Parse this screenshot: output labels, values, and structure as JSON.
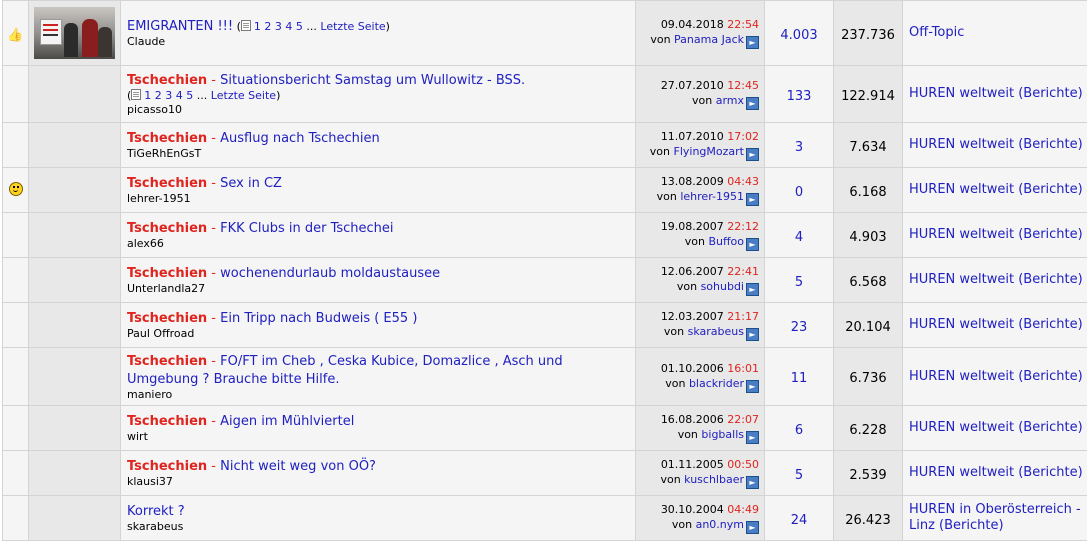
{
  "threads": [
    {
      "row_icon": "thumbs-up-icon",
      "has_thumbnail": true,
      "prefix": "",
      "title": "EMIGRANTEN !!!",
      "pages": [
        "1",
        "2",
        "3",
        "4",
        "5"
      ],
      "pages_ellipsis": "...",
      "last_page_label": "Letzte Seite",
      "starter": "Claude",
      "last_date": "09.04.2018",
      "last_time": "22:54",
      "last_by_label": "von",
      "last_user": "Panama Jack",
      "replies": "4.003",
      "views": "237.736",
      "forum": "Off-Topic"
    },
    {
      "row_icon": "",
      "has_thumbnail": false,
      "prefix": "Tschechien",
      "title": "Situationsbericht Samstag um Wullowitz - BSS.",
      "pages": [
        "1",
        "2",
        "3",
        "4",
        "5"
      ],
      "pages_ellipsis": "...",
      "last_page_label": "Letzte Seite",
      "starter": "picasso10",
      "last_date": "27.07.2010",
      "last_time": "12:45",
      "last_by_label": "von",
      "last_user": "armx",
      "replies": "133",
      "views": "122.914",
      "forum": "HUREN weltweit (Berichte)"
    },
    {
      "row_icon": "",
      "has_thumbnail": false,
      "prefix": "Tschechien",
      "title": "Ausflug nach Tschechien",
      "pages": [],
      "starter": "TiGeRhEnGsT",
      "last_date": "11.07.2010",
      "last_time": "17:02",
      "last_by_label": "von",
      "last_user": "FlyingMozart",
      "replies": "3",
      "views": "7.634",
      "forum": "HUREN weltweit (Berichte)"
    },
    {
      "row_icon": "smiley-icon",
      "has_thumbnail": false,
      "prefix": "Tschechien",
      "title": "Sex in CZ",
      "pages": [],
      "starter": "lehrer-1951",
      "last_date": "13.08.2009",
      "last_time": "04:43",
      "last_by_label": "von",
      "last_user": "lehrer-1951",
      "replies": "0",
      "views": "6.168",
      "forum": "HUREN weltweit (Berichte)"
    },
    {
      "row_icon": "",
      "has_thumbnail": false,
      "prefix": "Tschechien",
      "title": "FKK Clubs in der Tschechei",
      "pages": [],
      "starter": "alex66",
      "last_date": "19.08.2007",
      "last_time": "22:12",
      "last_by_label": "von",
      "last_user": "Buffoo",
      "replies": "4",
      "views": "4.903",
      "forum": "HUREN weltweit (Berichte)"
    },
    {
      "row_icon": "",
      "has_thumbnail": false,
      "prefix": "Tschechien",
      "title": "wochenendurlaub moldaustausee",
      "pages": [],
      "starter": "Unterlandla27",
      "last_date": "12.06.2007",
      "last_time": "22:41",
      "last_by_label": "von",
      "last_user": "sohubdi",
      "replies": "5",
      "views": "6.568",
      "forum": "HUREN weltweit (Berichte)"
    },
    {
      "row_icon": "",
      "has_thumbnail": false,
      "prefix": "Tschechien",
      "title": "Ein Tripp nach Budweis ( E55 )",
      "pages": [],
      "starter": "Paul Offroad",
      "last_date": "12.03.2007",
      "last_time": "21:17",
      "last_by_label": "von",
      "last_user": "skarabeus",
      "replies": "23",
      "views": "20.104",
      "forum": "HUREN weltweit (Berichte)"
    },
    {
      "row_icon": "",
      "has_thumbnail": false,
      "prefix": "Tschechien",
      "title": "FO/FT im Cheb , Ceska Kubice, Domazlice , Asch und Umgebung ? Brauche bitte Hilfe.",
      "pages": [],
      "starter": "maniero",
      "last_date": "01.10.2006",
      "last_time": "16:01",
      "last_by_label": "von",
      "last_user": "blackrider",
      "replies": "11",
      "views": "6.736",
      "forum": "HUREN weltweit (Berichte)"
    },
    {
      "row_icon": "",
      "has_thumbnail": false,
      "prefix": "Tschechien",
      "title": "Aigen im Mühlviertel",
      "pages": [],
      "starter": "wirt",
      "last_date": "16.08.2006",
      "last_time": "22:07",
      "last_by_label": "von",
      "last_user": "bigballs",
      "replies": "6",
      "views": "6.228",
      "forum": "HUREN weltweit (Berichte)"
    },
    {
      "row_icon": "",
      "has_thumbnail": false,
      "prefix": "Tschechien",
      "title": "Nicht weit weg von OÖ?",
      "pages": [],
      "starter": "klausi37",
      "last_date": "01.11.2005",
      "last_time": "00:50",
      "last_by_label": "von",
      "last_user": "kuschlbaer",
      "replies": "5",
      "views": "2.539",
      "forum": "HUREN weltweit (Berichte)"
    },
    {
      "row_icon": "",
      "has_thumbnail": false,
      "prefix": "",
      "title": "Korrekt ?",
      "pages": [],
      "starter": "skarabeus",
      "last_date": "30.10.2004",
      "last_time": "04:49",
      "last_by_label": "von",
      "last_user": "an0.nym",
      "replies": "24",
      "views": "26.423",
      "forum": "HUREN in Oberösterreich - Linz (Berichte)"
    }
  ]
}
